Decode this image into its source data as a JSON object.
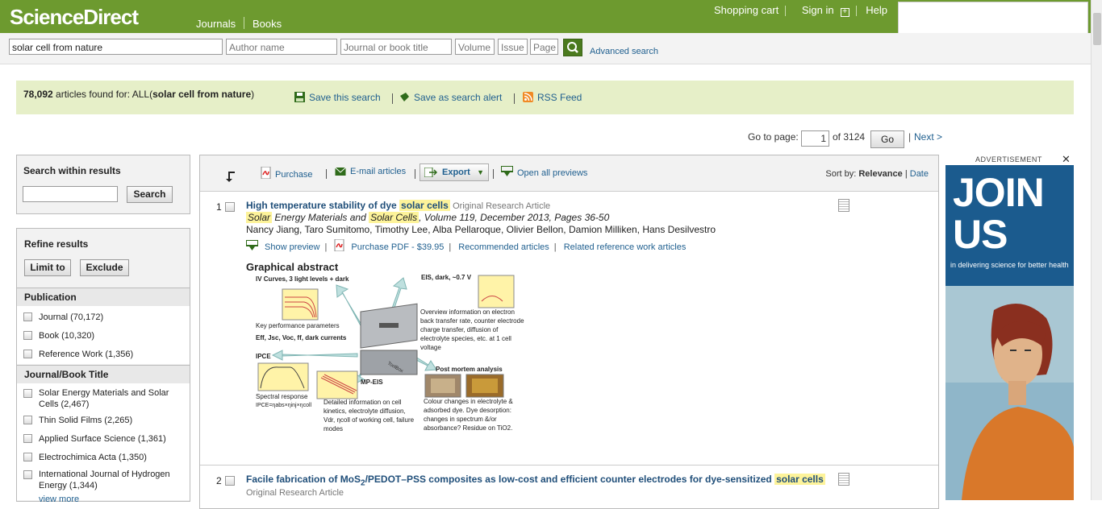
{
  "header": {
    "logo": "ScienceDirect",
    "nav": [
      "Journals",
      "Books"
    ],
    "links": [
      "Shopping cart",
      "Sign in",
      "Help"
    ]
  },
  "search": {
    "query": "solar cell from nature",
    "author_placeholder": "Author name",
    "journal_placeholder": "Journal or book title",
    "volume_placeholder": "Volume",
    "issue_placeholder": "Issue",
    "page_placeholder": "Page",
    "advanced": "Advanced search"
  },
  "results_bar": {
    "count": "78,092",
    "found_text": " articles found for: ALL(",
    "query_bold": "solar cell from nature",
    "close_paren": ")",
    "save_search": "Save this search",
    "save_alert": "Save as search alert",
    "rss": "RSS Feed"
  },
  "pager": {
    "label": "Go to page:",
    "current": "1",
    "of_total": "of 3124",
    "go": "Go",
    "next": "Next >"
  },
  "sidebar": {
    "search_within_title": "Search within results",
    "search_button": "Search",
    "refine_title": "Refine results",
    "limit_button": "Limit to",
    "exclude_button": "Exclude",
    "publication_title": "Publication",
    "publication": [
      "Journal (70,172)",
      "Book (10,320)",
      "Reference Work (1,356)"
    ],
    "jb_title": "Journal/Book Title",
    "jb_items": [
      "Solar Energy Materials and Solar Cells (2,467)",
      "Thin Solid Films (2,265)",
      "Applied Surface Science (1,361)",
      "Electrochimica Acta (1,350)",
      "International Journal of Hydrogen Energy (1,344)"
    ],
    "view_more": "view more"
  },
  "toolbar": {
    "purchase": "Purchase",
    "email": "E-mail articles",
    "export": "Export",
    "open_previews": "Open all previews",
    "sort_label": "Sort by: ",
    "sort_relevance": "Relevance",
    "sort_sep": " | ",
    "sort_date": "Date"
  },
  "results": [
    {
      "num": "1",
      "title_pre": "High temperature stability of dye ",
      "title_hl": "solar cells",
      "type": "Original Research Article",
      "journal_hl1": "Solar",
      "journal_mid": " Energy Materials and ",
      "journal_hl2": "Solar Cells",
      "journal_post": ", Volume 119, December 2013, Pages 36-50",
      "authors": "Nancy Jiang, Taro Sumitomo, Timothy Lee, Alba Pellaroque, Olivier Bellon, Damion Milliken, Hans Desilvestro",
      "show_preview": "Show preview",
      "purchase_pdf": "Purchase PDF - $39.95",
      "recommended": "Recommended articles",
      "related": "Related reference work articles",
      "ga_heading": "Graphical abstract",
      "ga_text": {
        "iv": "IV Curves, 3 light levels + dark",
        "eis": "EIS, dark, ~0.7 V",
        "overview": "Overview information on electron back transfer rate, counter electrode charge transfer, diffusion of electrolyte species, etc. at 1 cell voltage",
        "kpp": "Key performance parameters",
        "eff": "Eff, Jsc, Voc, ff, dark currents",
        "ipce": "IPCE",
        "mpeis": "MP-EIS",
        "pma": "Post mortem analysis",
        "spectral": "Spectral response",
        "ipce_eq": "IPCE=ηabs×ηinj×ηcoll",
        "detailed": "Detailed information on cell kinetics, electrolyte diffusion, Vdr, ηcoll of working cell, failure modes",
        "colour": "Colour changes in electrolyte & adsorbed dye. Dye desorption: changes in spectrum &/or absorbance? Residue on TiO2.",
        "toolbox": "ToolBox"
      }
    },
    {
      "num": "2",
      "title_pre": "Facile fabrication of MoS",
      "title_sub": "2",
      "title_mid": "/PEDOT–PSS composites as low-cost and efficient counter electrodes for dye-sensitized ",
      "title_hl": "solar cells",
      "type": "Original Research Article"
    }
  ],
  "ad": {
    "label": "ADVERTISEMENT",
    "close": "✕",
    "big": "JOIN US",
    "small": "in delivering science for better health"
  },
  "colors": {
    "brand_green": "#6d9a2f",
    "result_bar": "#e6efc8",
    "link": "#1f5f8f",
    "highlight": "#fdf39a",
    "ad_blue": "#1b5b8e"
  }
}
